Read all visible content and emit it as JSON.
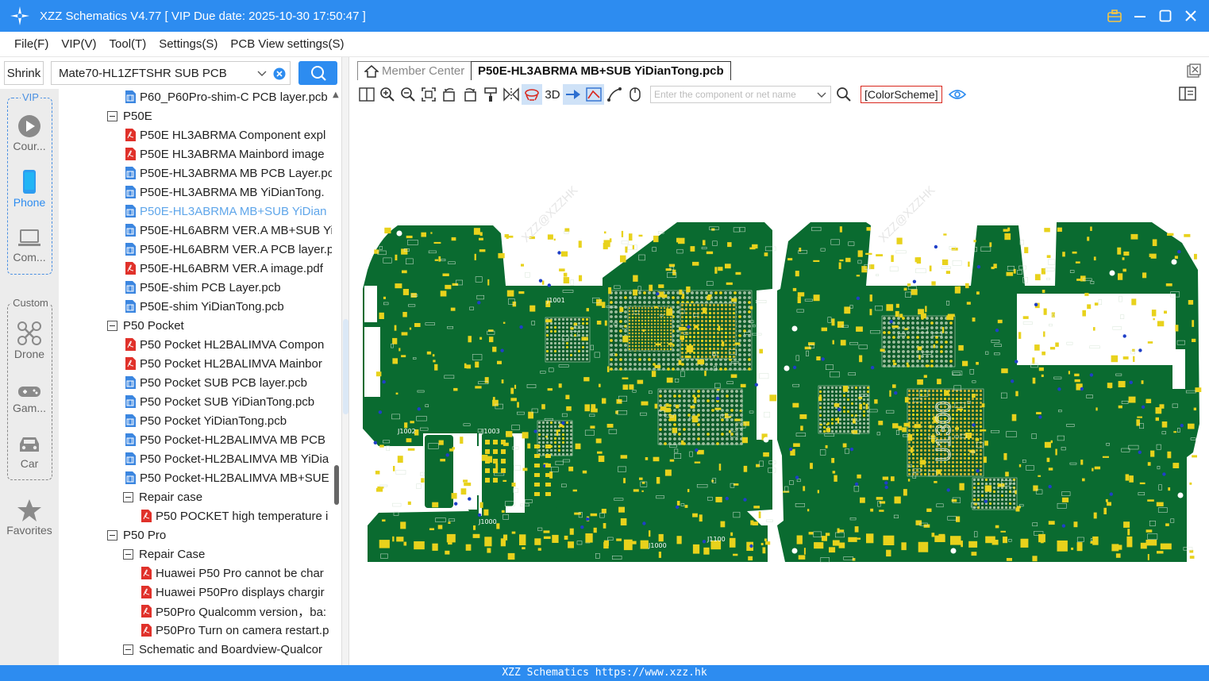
{
  "window": {
    "title": "XZZ Schematics V4.77 [ VIP Due date: 2025-10-30 17:50:47 ]"
  },
  "menu": [
    "File(F)",
    "VIP(V)",
    "Tool(T)",
    "Settings(S)",
    "PCB View settings(S)"
  ],
  "search": {
    "shrink_label": "Shrink",
    "value": "Mate70-HL1ZFTSHR SUB PCB"
  },
  "rail": {
    "vip_label": "VIP",
    "custom_label": "Custom",
    "items": [
      {
        "label": "Cour...",
        "icon": "play-circle-icon"
      },
      {
        "label": "Phone",
        "icon": "phone-icon"
      },
      {
        "label": "Com...",
        "icon": "laptop-icon"
      },
      {
        "label": "Drone",
        "icon": "drone-icon"
      },
      {
        "label": "Gam...",
        "icon": "gamepad-icon"
      },
      {
        "label": "Car",
        "icon": "car-icon"
      },
      {
        "label": "Favorites",
        "icon": "star-icon"
      }
    ],
    "colors": {
      "active": "#2d8cf0",
      "inactive": "#8a8a8a"
    }
  },
  "tree": [
    {
      "label": "P60_P60Pro-shim-C PCB layer.pcb",
      "type": "pcb",
      "level": 2
    },
    {
      "label": "P50E",
      "type": "folder",
      "level": 1
    },
    {
      "label": "P50E HL3ABRMA Component expl",
      "type": "pdf",
      "level": 2
    },
    {
      "label": "P50E HL3ABRMA Mainbord image",
      "type": "pdf",
      "level": 2
    },
    {
      "label": "P50E-HL3ABRMA MB PCB Layer.pc",
      "type": "pcb",
      "level": 2
    },
    {
      "label": "P50E-HL3ABRMA MB YiDianTong.",
      "type": "pcb",
      "level": 2
    },
    {
      "label": "P50E-HL3ABRMA MB+SUB YiDian",
      "type": "pcb",
      "level": 2,
      "active": true
    },
    {
      "label": "P50E-HL6ABRM VER.A MB+SUB Yi",
      "type": "pcb",
      "level": 2
    },
    {
      "label": "P50E-HL6ABRM VER.A PCB layer.p",
      "type": "pcb",
      "level": 2
    },
    {
      "label": "P50E-HL6ABRM VER.A image.pdf",
      "type": "pdf",
      "level": 2
    },
    {
      "label": "P50E-shim PCB Layer.pcb",
      "type": "pcb",
      "level": 2
    },
    {
      "label": "P50E-shim YiDianTong.pcb",
      "type": "pcb",
      "level": 2
    },
    {
      "label": "P50 Pocket",
      "type": "folder",
      "level": 1
    },
    {
      "label": "P50 Pocket HL2BALIMVA Compon",
      "type": "pdf",
      "level": 2
    },
    {
      "label": "P50 Pocket HL2BALIMVA Mainbor",
      "type": "pdf",
      "level": 2
    },
    {
      "label": "P50 Pocket SUB PCB layer.pcb",
      "type": "pcb",
      "level": 2
    },
    {
      "label": "P50 Pocket SUB YiDianTong.pcb",
      "type": "pcb",
      "level": 2
    },
    {
      "label": "P50 Pocket YiDianTong.pcb",
      "type": "pcb",
      "level": 2
    },
    {
      "label": "P50 Pocket-HL2BALIMVA MB PCB",
      "type": "pcb",
      "level": 2
    },
    {
      "label": "P50 Pocket-HL2BALIMVA MB YiDia",
      "type": "pcb",
      "level": 2
    },
    {
      "label": "P50 Pocket-HL2BALIMVA MB+SUE",
      "type": "pcb",
      "level": 2
    },
    {
      "label": "Repair case",
      "type": "folder",
      "level": 2
    },
    {
      "label": "P50 POCKET high temperature i",
      "type": "pdf",
      "level": 3
    },
    {
      "label": "P50 Pro",
      "type": "folder",
      "level": 1
    },
    {
      "label": "Repair Case",
      "type": "folder",
      "level": 2
    },
    {
      "label": "Huawei P50 Pro cannot be char",
      "type": "pdf",
      "level": 3
    },
    {
      "label": "Huawei P50Pro displays chargir",
      "type": "pdf",
      "level": 3
    },
    {
      "label": "P50Pro Qualcomm version，ba:",
      "type": "pdf",
      "level": 3
    },
    {
      "label": "P50Pro Turn on camera restart.p",
      "type": "pdf",
      "level": 3
    },
    {
      "label": "Schematic and Boardview-Qualcor",
      "type": "folder",
      "level": 2
    }
  ],
  "tabs": {
    "member": "Member Center",
    "file": "P50E-HL3ABRMA MB+SUB YiDianTong.pcb"
  },
  "toolbar": {
    "three_d": "3D",
    "net_placeholder": "Enter the component or net name",
    "color_scheme": "[ColorScheme]"
  },
  "board": {
    "watermark": "XZZ@XZZHK",
    "labels": [
      "J1001",
      "J1002",
      "J1003",
      "J1000",
      "J1100",
      "J1000",
      "U1300"
    ],
    "colors": {
      "pcb": "#0a6b30",
      "pad": "#e8d21c",
      "via": "#1f3fc8",
      "silk": "#d8e6d8"
    }
  },
  "status": "XZZ Schematics https://www.xzz.hk"
}
